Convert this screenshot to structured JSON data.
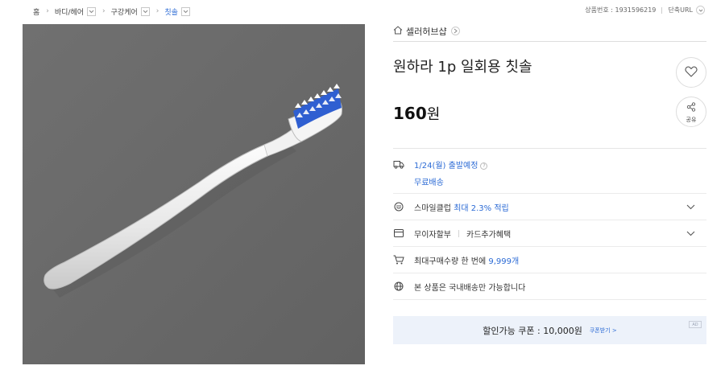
{
  "breadcrumb": {
    "items": [
      "홈",
      "바디/헤어",
      "구강케어",
      "칫솔"
    ]
  },
  "meta": {
    "product_number": "상품번호 : 1931596219",
    "short_url": "단축URL"
  },
  "seller": {
    "name": "셀러허브샵"
  },
  "product": {
    "title": "원하라 1p 일회용 칫솔",
    "price": "160",
    "price_unit": "원"
  },
  "actions": {
    "share_label": "공유"
  },
  "shipping": {
    "date": "1/24(월) 출발예정",
    "help": "?",
    "free": "무료배송"
  },
  "smileclub": {
    "label": "스마일클럽",
    "benefit": "최대 2.3% 적립"
  },
  "installment": {
    "label": "무이자할부",
    "card": "카드추가혜택"
  },
  "max_purchase": {
    "label": "최대구매수량 한 번에",
    "value": "9,999개"
  },
  "domestic": {
    "label": "본 상품은 국내배송만 가능합니다"
  },
  "coupon": {
    "label": "할인가능 쿠폰 : 10,000원",
    "download": "쿠폰받기 >",
    "ad": "AD"
  },
  "colors": {
    "accent": "#2c6bd5",
    "coupon_bg": "#edf2fa",
    "photo_bg": "#6b6b6b"
  }
}
